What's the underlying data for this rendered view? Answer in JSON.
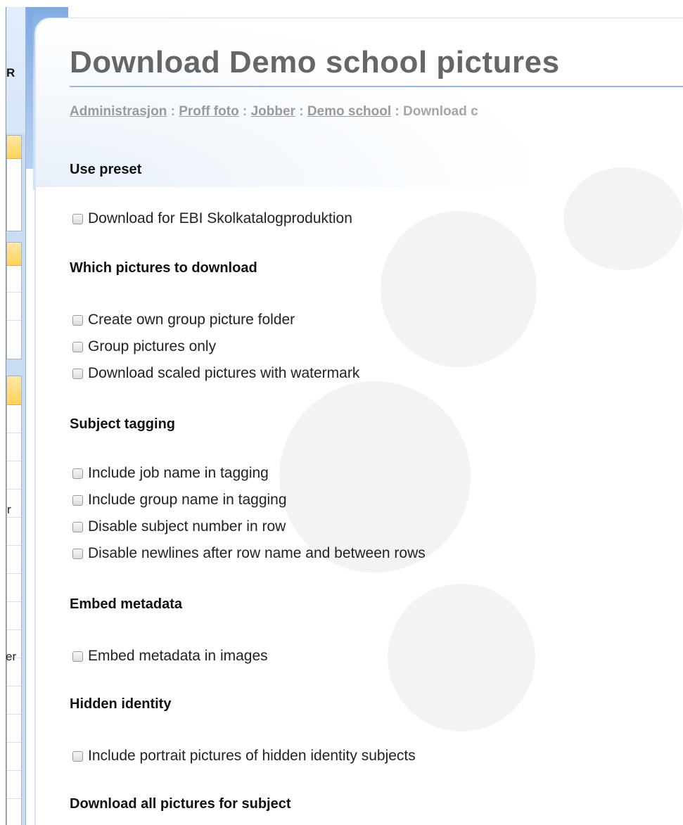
{
  "sidebar": {
    "header_fragment": "R",
    "fragment_r": "r",
    "fragment_er": "er"
  },
  "page": {
    "title": "Download Demo school pictures",
    "breadcrumb": {
      "items": [
        "Administrasjon",
        "Proff foto",
        "Jobber",
        "Demo school"
      ],
      "separator": ":",
      "current": "Download c"
    }
  },
  "sections": [
    {
      "heading": "Use preset",
      "options": [
        {
          "label": "Download for EBI Skolkatalogproduktion",
          "checked": false
        }
      ]
    },
    {
      "heading": "Which pictures to download",
      "options": [
        {
          "label": "Create own group picture folder",
          "checked": false
        },
        {
          "label": "Group pictures only",
          "checked": false
        },
        {
          "label": "Download scaled pictures with watermark",
          "checked": false
        }
      ]
    },
    {
      "heading": "Subject tagging",
      "options": [
        {
          "label": "Include job name in tagging",
          "checked": false
        },
        {
          "label": "Include group name in tagging",
          "checked": false
        },
        {
          "label": "Disable subject number in row",
          "checked": false
        },
        {
          "label": "Disable newlines after row name and between rows",
          "checked": false
        }
      ]
    },
    {
      "heading": "Embed metadata",
      "options": [
        {
          "label": "Embed metadata in images",
          "checked": false
        }
      ]
    },
    {
      "heading": "Hidden identity",
      "options": [
        {
          "label": "Include portrait pictures of hidden identity subjects",
          "checked": false
        }
      ]
    },
    {
      "heading": "Download all pictures for subject",
      "options": []
    }
  ]
}
